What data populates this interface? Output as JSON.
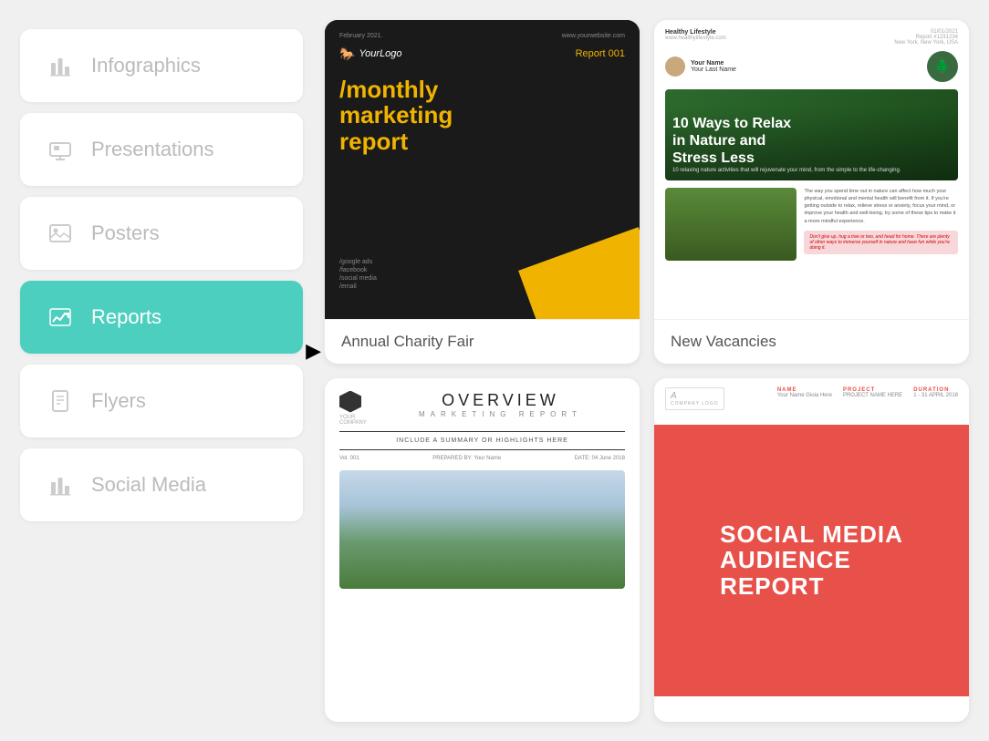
{
  "sidebar": {
    "items": [
      {
        "id": "infographics",
        "label": "Infographics",
        "icon": "chart-bar"
      },
      {
        "id": "presentations",
        "label": "Presentations",
        "icon": "image-slide"
      },
      {
        "id": "posters",
        "label": "Posters",
        "icon": "image"
      },
      {
        "id": "reports",
        "label": "Reports",
        "icon": "chart-trend",
        "active": true
      },
      {
        "id": "flyers",
        "label": "Flyers",
        "icon": "document"
      },
      {
        "id": "social-media",
        "label": "Social Media",
        "icon": "chart-bar2"
      }
    ]
  },
  "cards": [
    {
      "id": "annual-charity-fair",
      "label": "Annual Charity Fair",
      "preview": {
        "date": "February 2021.",
        "website": "www.yourwebsite.com",
        "logo": "YourLogo",
        "report_num": "Report 001",
        "title": "/monthly\nmarketing\nreport",
        "channels": [
          "/google ads",
          "/facebook",
          "/social media",
          "/email"
        ]
      }
    },
    {
      "id": "new-vacancies",
      "label": "New Vacancies",
      "preview": {
        "brand": "Healthy Lifestyle",
        "website": "www.healthylifestyle.com",
        "date": "01/01/2021",
        "report_id": "Report #1231234",
        "location": "New York, New York, USA",
        "profile_name": "Your Name",
        "profile_sub": "Your Last Name",
        "hero_title": "10 Ways to Relax\nin Nature and\nStress Less",
        "hero_subtitle": "10 relaxing nature activities that will rejuvenate your mind, from the simple to the life-changing.",
        "body_text": "The way you spend time out in nature can affect how much your physical, emotional and mental health will benefit from it. If you're getting outside to relax, relieve stress or anxiety, focus your mind, or improve your health and well-being, try some of these tips to make it a more mindful experience.",
        "pink_quote": "Don't give up, hug a tree or two, and head for home. There are plenty of other ways to immerse yourself in nature and have fun while you're doing it."
      }
    },
    {
      "id": "overview-marketing",
      "label": "",
      "preview": {
        "title": "OVERVIEW",
        "subtitle": "MARKETING REPORT",
        "summary": "INCLUDE A SUMMARY OR HIGHLIGHTS HERE",
        "vol": "Vol. 001",
        "prepared": "PREPARED BY: Your Name",
        "date": "DATE: 04 June 2018"
      }
    },
    {
      "id": "social-media-report",
      "label": "",
      "preview": {
        "logo_letter": "A",
        "logo_sub": "Company Logo",
        "name_label": "NAME",
        "project_label": "PROJECT",
        "duration_label": "DURATION",
        "name_val": "Your Name\nGioia Here",
        "project_val": "PROJECT\nNAME HERE",
        "duration_val": "1 - 31\nAPRIL 2018",
        "report_title": "SOCIAL MEDIA\nAUDIENCE\nREPORT"
      }
    }
  ],
  "colors": {
    "active_bg": "#4dcfbf",
    "marketing_bg": "#1a1a1a",
    "marketing_accent": "#f0b400",
    "social_pink": "#e8504a",
    "sidebar_inactive_text": "#bbb",
    "sidebar_inactive_bg": "#fff"
  }
}
